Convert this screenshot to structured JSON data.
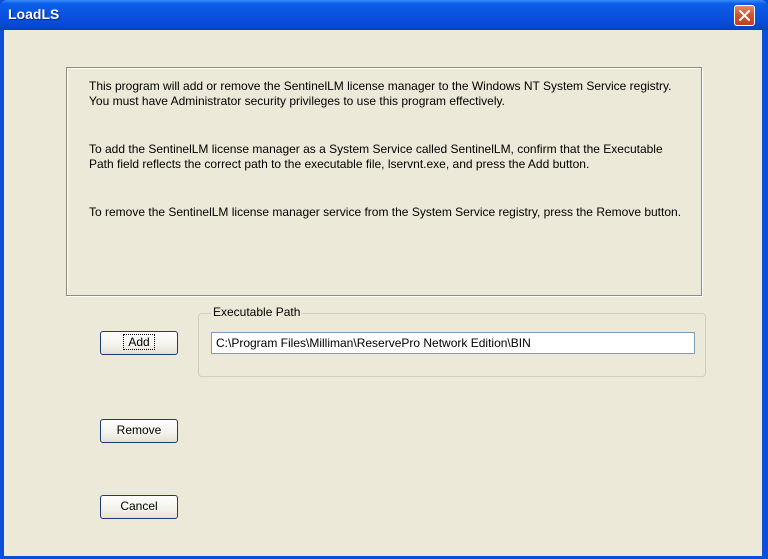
{
  "window": {
    "title": "LoadLS"
  },
  "info": {
    "para1": "This program will add or remove the SentinelLM license manager to the Windows NT System Service registry. You must have Administrator security privileges to use this program effectively.",
    "para2": "To add the SentinelLM license manager as a System Service called SentinelLM, confirm that the Executable Path field reflects the correct path to the executable file, lservnt.exe, and press the Add button.",
    "para3": "To remove the SentinelLM license manager service from the System Service registry, press the Remove button."
  },
  "buttons": {
    "add": "Add",
    "remove": "Remove",
    "cancel": "Cancel"
  },
  "executable_path": {
    "label": "Executable Path",
    "value": "C:\\Program Files\\Milliman\\ReservePro Network Edition\\BIN"
  },
  "icons": {
    "close": "close-icon"
  },
  "colors": {
    "titlebar": "#0a53e0",
    "close": "#d4532e",
    "face": "#ece9d8"
  }
}
